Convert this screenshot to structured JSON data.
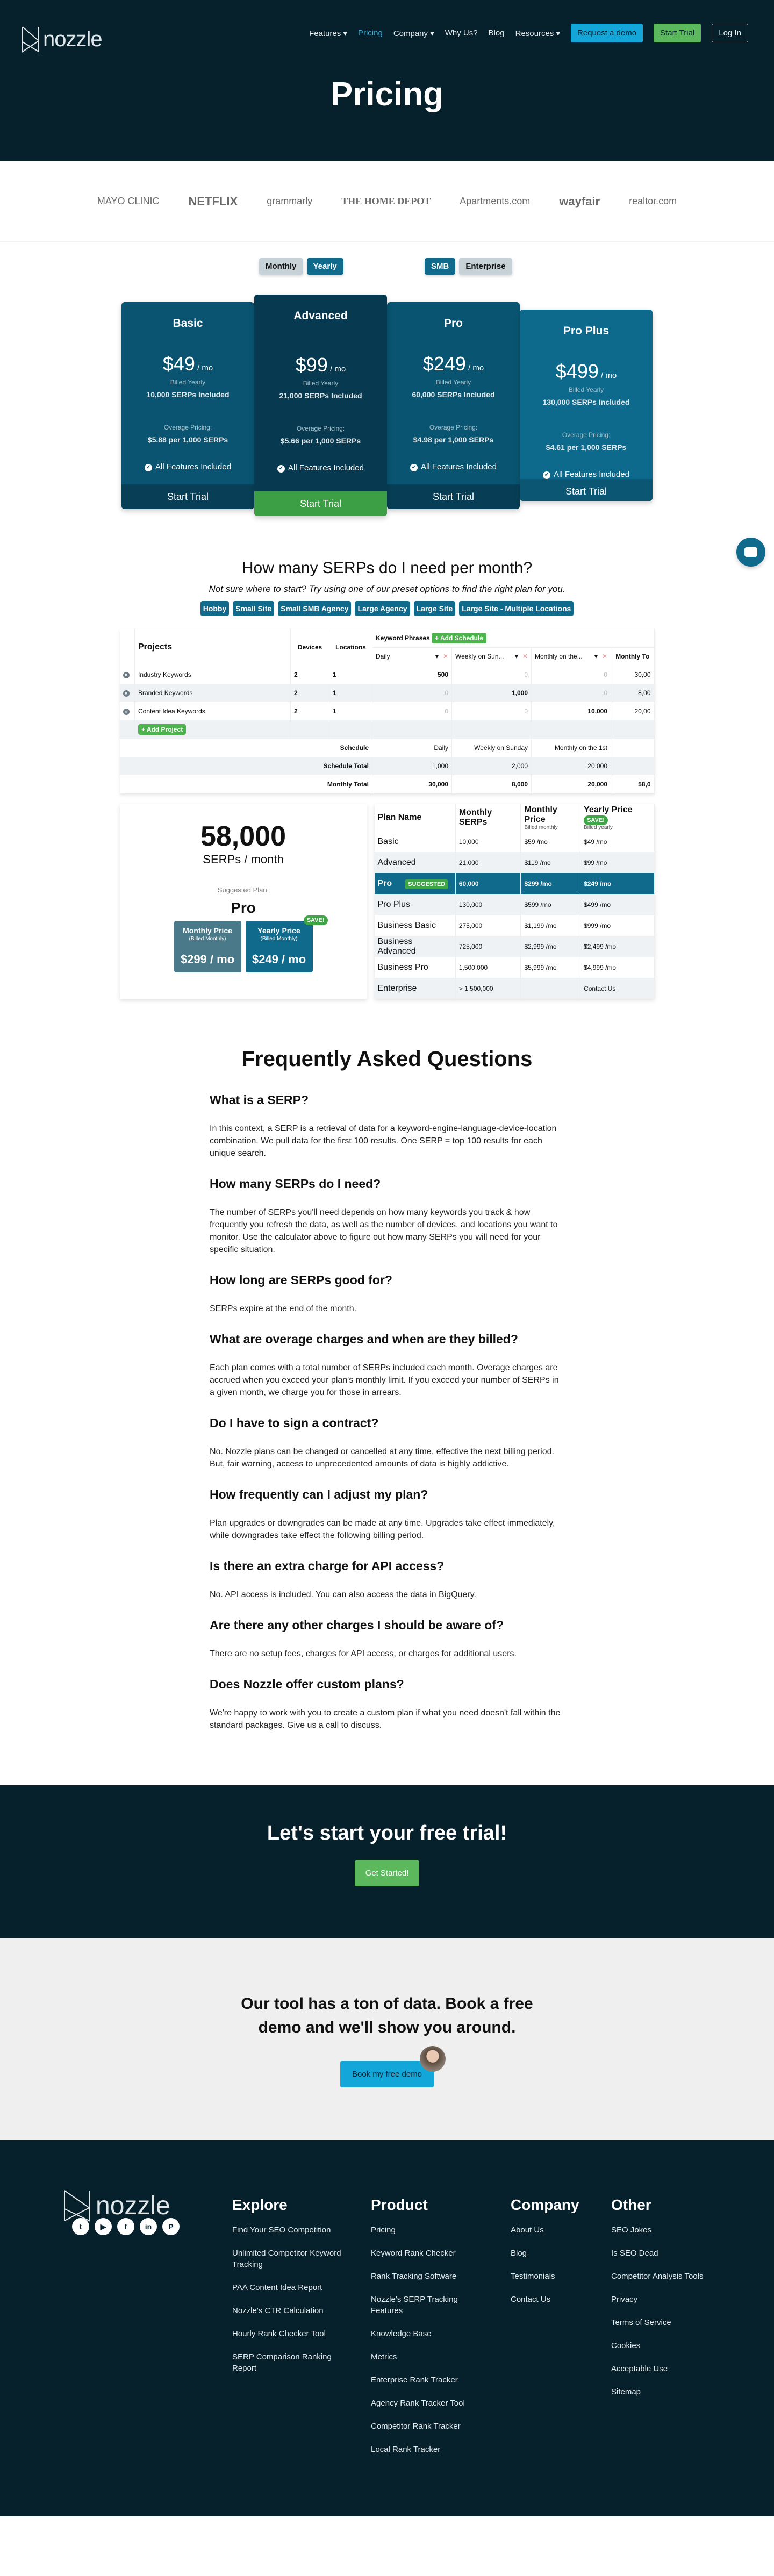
{
  "nav": {
    "logo": "nozzle",
    "links": [
      "Features ▾",
      "Pricing",
      "Company ▾",
      "Why Us?",
      "Blog",
      "Resources ▾"
    ],
    "request_demo": "Request a demo",
    "start_trial": "Start Trial",
    "login": "Log In"
  },
  "hero": {
    "title": "Pricing"
  },
  "logos": [
    "MAYO CLINIC",
    "NETFLIX",
    "grammarly",
    "THE HOME DEPOT",
    "Apartments.com",
    "wayfair",
    "realtor.com"
  ],
  "toggles": {
    "billing": [
      "Monthly",
      "Yearly"
    ],
    "segment": [
      "SMB",
      "Enterprise"
    ]
  },
  "plans": [
    {
      "name": "Basic",
      "price": "$49",
      "per": " / mo",
      "billed": "Billed Yearly",
      "serps": "10,000 SERPs Included",
      "overage_label": "Overage Pricing:",
      "overage": "$5.88 per 1,000 SERPs",
      "feature": "All Features Included",
      "cta": "Start Trial"
    },
    {
      "name": "Advanced",
      "price": "$99",
      "per": " / mo",
      "billed": "Billed Yearly",
      "serps": "21,000 SERPs Included",
      "overage_label": "Overage Pricing:",
      "overage": "$5.66 per 1,000 SERPs",
      "feature": "All Features Included",
      "cta": "Start Trial"
    },
    {
      "name": "Pro",
      "price": "$249",
      "per": " / mo",
      "billed": "Billed Yearly",
      "serps": "60,000 SERPs Included",
      "overage_label": "Overage Pricing:",
      "overage": "$4.98 per 1,000 SERPs",
      "feature": "All Features Included",
      "cta": "Start Trial"
    },
    {
      "name": "Pro Plus",
      "price": "$499",
      "per": " / mo",
      "billed": "Billed Yearly",
      "serps": "130,000 SERPs Included",
      "overage_label": "Overage Pricing:",
      "overage": "$4.61 per 1,000 SERPs",
      "feature": "All Features Included",
      "cta": "Start Trial"
    }
  ],
  "calculator": {
    "title": "How many SERPs do I need per month?",
    "subtitle": "Not sure where to start? Try using one of our preset options to find the right plan for you.",
    "presets": [
      "Hobby",
      "Small Site",
      "Small SMB Agency",
      "Large Agency",
      "Large Site",
      "Large Site - Multiple Locations"
    ],
    "headers": {
      "projects": "Projects",
      "devices": "Devices",
      "locations": "Locations",
      "keyword_phrases": "Keyword Phrases",
      "add_schedule": "+ Add Schedule",
      "schedules": [
        "Daily",
        "Weekly on Sun...",
        "Monthly on the..."
      ],
      "monthly_total": "Monthly To"
    },
    "rows": [
      {
        "name": "Industry Keywords",
        "devices": "2",
        "locations": "1",
        "vals": [
          "500",
          "0",
          "0"
        ],
        "total": "30,00"
      },
      {
        "name": "Branded Keywords",
        "devices": "2",
        "locations": "1",
        "vals": [
          "0",
          "1,000",
          "0"
        ],
        "total": "8,00"
      },
      {
        "name": "Content Idea Keywords",
        "devices": "2",
        "locations": "1",
        "vals": [
          "0",
          "0",
          "10,000"
        ],
        "total": "20,00"
      }
    ],
    "add_project": "+ Add Project",
    "schedule_label": "Schedule",
    "schedule_names": [
      "Daily",
      "Weekly on Sunday",
      "Monthly on the 1st"
    ],
    "schedule_total_label": "Schedule Total",
    "schedule_totals": [
      "1,000",
      "2,000",
      "20,000"
    ],
    "monthly_total_label": "Monthly Total",
    "monthly_totals": [
      "30,000",
      "8,000",
      "20,000",
      "58,0"
    ]
  },
  "result": {
    "serps": "58,000",
    "per": "SERPs / month",
    "suggested_label": "Suggested Plan:",
    "plan": "Pro",
    "monthly": {
      "title": "Monthly Price",
      "sub": "(Billed Monthly)",
      "value": "$299 / mo"
    },
    "yearly": {
      "title": "Yearly Price",
      "sub": "(Billed Monthly)",
      "value": "$249 / mo"
    },
    "save": "SAVE!"
  },
  "plan_table": {
    "headers": {
      "name": "Plan Name",
      "serps": "Monthly SERPs",
      "monthly": "Monthly Price",
      "monthly_sub": "Billed monthly",
      "yearly": "Yearly Price",
      "yearly_sub": "Billed yearly",
      "save": "SAVE!"
    },
    "suggested_tag": "SUGGESTED",
    "rows": [
      {
        "name": "Basic",
        "serps": "10,000",
        "monthly": "$59 /mo",
        "yearly": "$49 /mo"
      },
      {
        "name": "Advanced",
        "serps": "21,000",
        "monthly": "$119 /mo",
        "yearly": "$99 /mo"
      },
      {
        "name": "Pro",
        "serps": "60,000",
        "monthly": "$299 /mo",
        "yearly": "$249 /mo"
      },
      {
        "name": "Pro Plus",
        "serps": "130,000",
        "monthly": "$599 /mo",
        "yearly": "$499 /mo"
      },
      {
        "name": "Business Basic",
        "serps": "275,000",
        "monthly": "$1,199 /mo",
        "yearly": "$999 /mo"
      },
      {
        "name": "Business Advanced",
        "serps": "725,000",
        "monthly": "$2,999 /mo",
        "yearly": "$2,499 /mo"
      },
      {
        "name": "Business Pro",
        "serps": "1,500,000",
        "monthly": "$5,999 /mo",
        "yearly": "$4,999 /mo"
      },
      {
        "name": "Enterprise",
        "serps": "> 1,500,000",
        "monthly": "",
        "yearly": "Contact Us"
      }
    ]
  },
  "faq": {
    "title": "Frequently Asked Questions",
    "items": [
      {
        "q": "What is a SERP?",
        "a": "In this context, a SERP is a retrieval of data for a keyword-engine-language-device-location combination. We pull data for the first 100 results. One SERP = top 100 results for each unique search."
      },
      {
        "q": "How many SERPs do I need?",
        "a": "The number of SERPs you'll need depends on how many keywords you track & how frequently you refresh the data, as well as the number of devices, and locations you want to monitor. Use the calculator above to figure out how many SERPs you will need for your specific situation."
      },
      {
        "q": "How long are SERPs good for?",
        "a": "SERPs expire at the end of the month."
      },
      {
        "q": "What are overage charges and when are they billed?",
        "a": "Each plan comes with a total number of SERPs included each month. Overage charges are accrued when you exceed your plan's monthly limit. If you exceed your number of SERPs in a given month, we charge you for those in arrears."
      },
      {
        "q": "Do I have to sign a contract?",
        "a": "No. Nozzle plans can be changed or cancelled at any time, effective the next billing period. But, fair warning, access to unprecedented amounts of data is highly addictive."
      },
      {
        "q": "How frequently can I adjust my plan?",
        "a": "Plan upgrades or downgrades can be made at any time. Upgrades take effect immediately, while downgrades take effect the following billing period."
      },
      {
        "q": "Is there an extra charge for API access?",
        "a": "No. API access is included. You can also access the data in BigQuery."
      },
      {
        "q": "Are there any other charges I should be aware of?",
        "a": "There are no setup fees, charges for API access, or charges for additional users."
      },
      {
        "q": "Does Nozzle offer custom plans?",
        "a": "We're happy to work with you to create a custom plan if what you need doesn't fall within the standard packages. Give us a call to discuss."
      }
    ]
  },
  "cta": {
    "title": "Let's start your free trial!",
    "button": "Get Started!"
  },
  "demo": {
    "title": "Our tool has a ton of data. Book a free demo and we'll show you around.",
    "button": "Book my free demo"
  },
  "footer": {
    "logo": "nozzle",
    "social": [
      "twitter",
      "youtube",
      "facebook",
      "linkedin",
      "pinterest"
    ],
    "columns": [
      {
        "title": "Explore",
        "links": [
          "Find Your SEO Competition",
          "Unlimited Competitor Keyword Tracking",
          "PAA Content Idea Report",
          "Nozzle's CTR Calculation",
          "Hourly Rank Checker Tool",
          "SERP Comparison Ranking Report"
        ]
      },
      {
        "title": "Product",
        "links": [
          "Pricing",
          "Keyword Rank Checker",
          "Rank Tracking Software",
          "Nozzle's SERP Tracking Features",
          "Knowledge Base",
          "Metrics",
          "Enterprise Rank Tracker",
          "Agency Rank Tracker Tool",
          "Competitor Rank Tracker",
          "Local Rank Tracker"
        ]
      },
      {
        "title": "Company",
        "links": [
          "About Us",
          "Blog",
          "Testimonials",
          "Contact Us"
        ]
      },
      {
        "title": "Other",
        "links": [
          "SEO Jokes",
          "Is SEO Dead",
          "Competitor Analysis Tools",
          "Privacy",
          "Terms of Service",
          "Cookies",
          "Acceptable Use",
          "Sitemap"
        ]
      }
    ]
  }
}
